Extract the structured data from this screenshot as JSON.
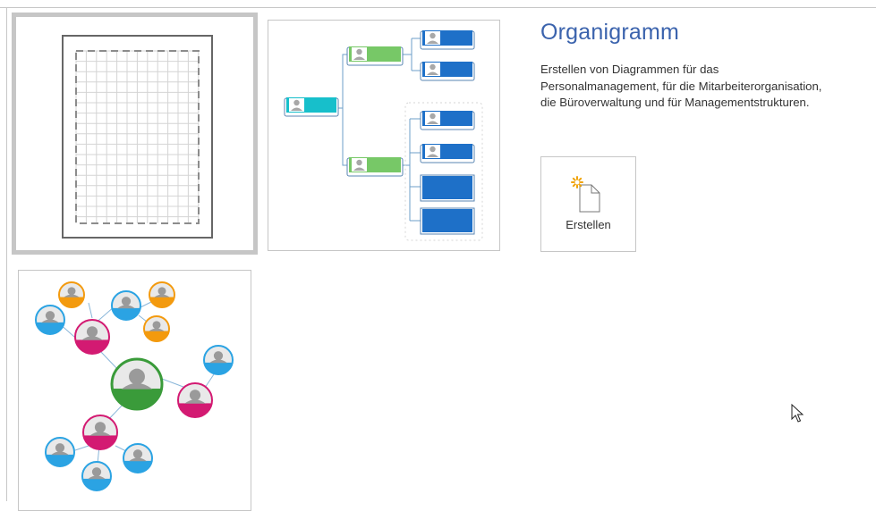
{
  "templates": [
    {
      "id": "blank",
      "selected": true,
      "icon": "blank-page-grid-icon"
    },
    {
      "id": "org-chart",
      "selected": false,
      "icon": "org-chart-diagram-icon"
    },
    {
      "id": "network",
      "selected": false,
      "icon": "people-network-diagram-icon"
    }
  ],
  "details": {
    "title": "Organigramm",
    "description_lines": [
      "Erstellen von Diagrammen für das",
      "Personalmanagement, für die Mitarbeiterorganisation,",
      "die Büroverwaltung und für Managementstrukturen."
    ]
  },
  "create_button": {
    "label": "Erstellen",
    "icon": "new-document-sparkle-icon"
  },
  "colors": {
    "title_blue": "#3b63ad",
    "org_green": "#77c867",
    "org_teal": "#17bfcb",
    "org_blue": "#1e70c8",
    "net_green": "#3a9b3a",
    "net_magenta": "#d31a72",
    "net_orange": "#f39a0e",
    "net_blue": "#2ba3e3",
    "selection_gray": "#c6c6c6"
  }
}
